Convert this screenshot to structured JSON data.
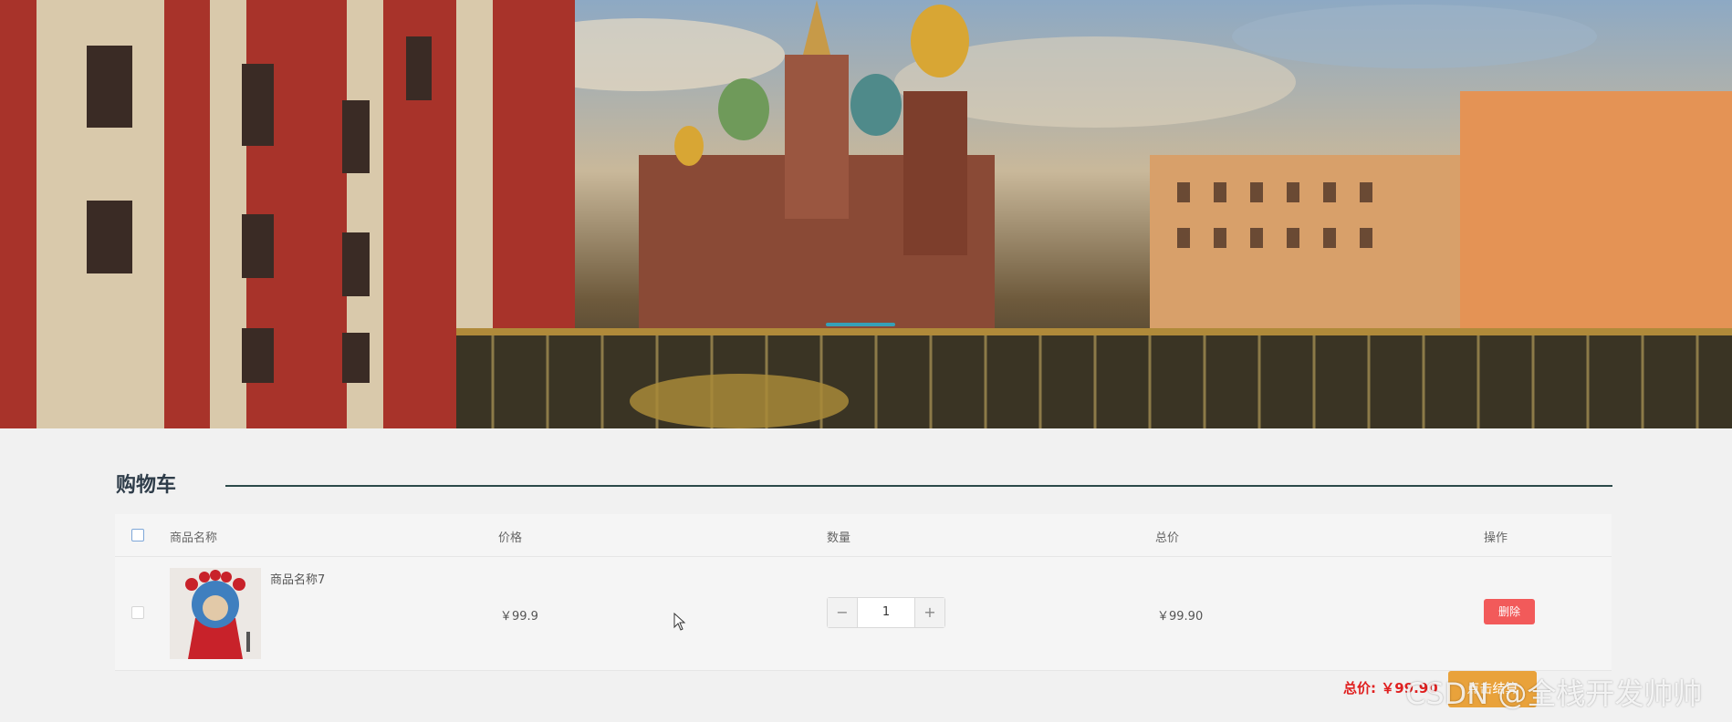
{
  "banner": {
    "image": "landscape photo of a cathedral with onion domes beside a canal bridge"
  },
  "section": {
    "title": "购物车"
  },
  "table": {
    "headers": {
      "name": "商品名称",
      "price": "价格",
      "quantity": "数量",
      "total": "总价",
      "action": "操作"
    },
    "rows": [
      {
        "name": "商品名称7",
        "price": "￥99.9",
        "quantity": "1",
        "total": "￥99.90",
        "delete_label": "删除"
      }
    ]
  },
  "summary": {
    "total_label": "总价: ￥99.90",
    "checkout_label": "点击结算"
  },
  "stepper": {
    "minus": "−",
    "plus": "+"
  },
  "watermark": "CSDN @全栈开发帅帅",
  "colors": {
    "accent_line": "#2c4a4a",
    "delete": "#f25a5a",
    "checkout": "#e9a23b",
    "total_text": "#e02020"
  }
}
